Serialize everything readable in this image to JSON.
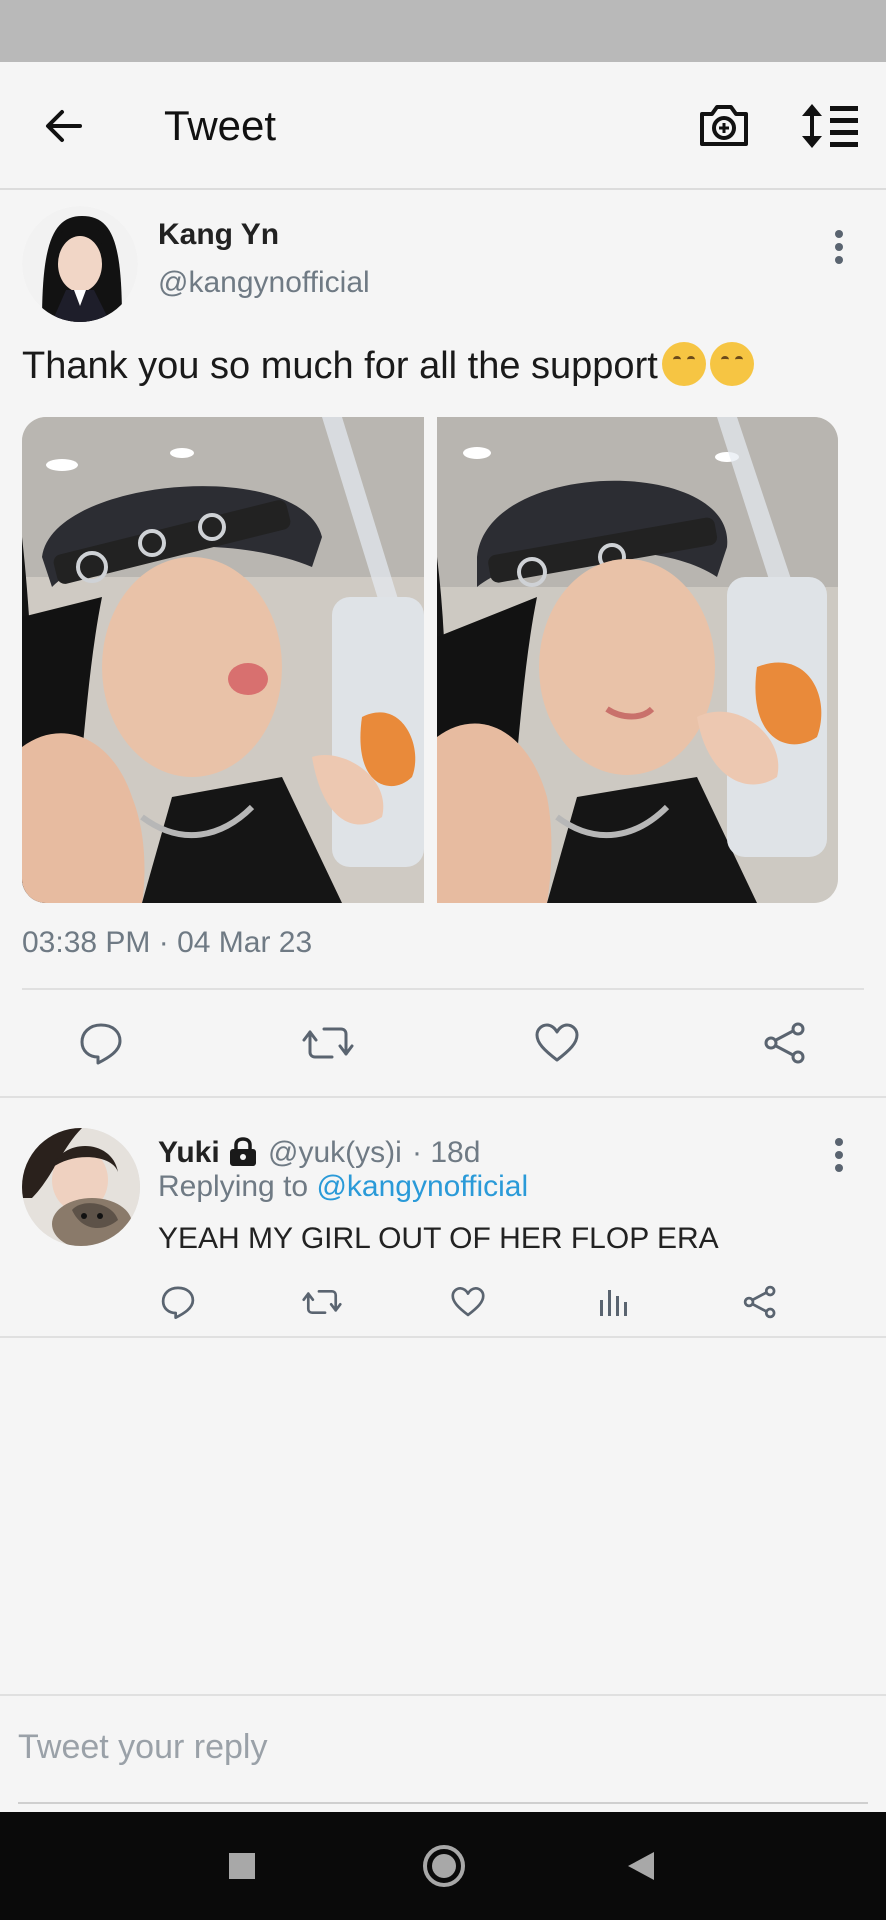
{
  "header": {
    "title": "Tweet"
  },
  "tweet": {
    "author_name": "Kang Yn",
    "author_handle": "@kangynofficial",
    "text": "Thank you so much for all the support",
    "timestamp": "03:38 PM · 04 Mar 23"
  },
  "reply": {
    "author_name": "Yuki",
    "author_handle": "@yuk(ys)i",
    "age": "· 18d",
    "replying_label": "Replying to",
    "replying_mention": "@kangynofficial",
    "text": "YEAH MY GIRL OUT OF HER FLOP ERA"
  },
  "composer": {
    "placeholder": "Tweet your reply"
  },
  "colors": {
    "accent": "#2a9ad8",
    "secondary_text": "#6f7a84"
  }
}
